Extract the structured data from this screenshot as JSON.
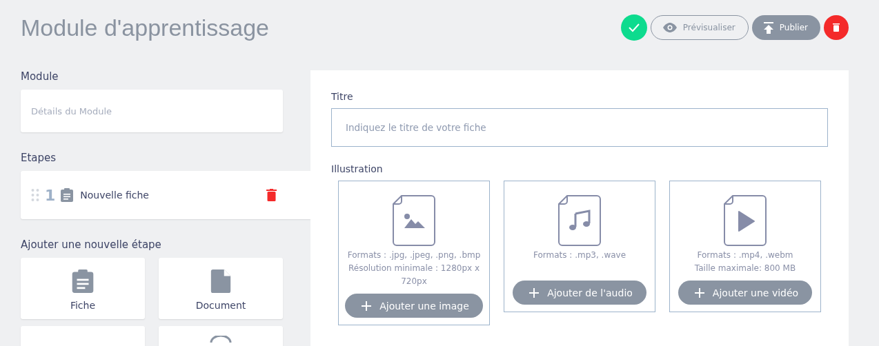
{
  "header": {
    "title": "Module d'apprentissage",
    "actions": [
      {
        "kind": "validate"
      },
      {
        "kind": "preview",
        "label": "Prévisualiser"
      },
      {
        "kind": "publish",
        "label": "Publier"
      },
      {
        "kind": "delete"
      }
    ]
  },
  "module": {
    "heading": "Module",
    "placeholder": "Détails du Module"
  },
  "steps": {
    "heading": "Etapes",
    "items": [
      {
        "number": "1",
        "kind": "sheet",
        "label": "Nouvelle fiche"
      }
    ]
  },
  "add_step": {
    "heading": "Ajouter une nouvelle étape",
    "options": [
      {
        "kind": "sheet",
        "label": "Fiche"
      },
      {
        "kind": "document",
        "label": "Document"
      },
      {
        "kind": "blank"
      },
      {
        "kind": "circle"
      }
    ]
  },
  "editor": {
    "title_label": "Titre",
    "title_placeholder": "Indiquez le titre de votre fiche",
    "illustration_label": "Illustration",
    "media": [
      {
        "kind": "image",
        "info": [
          "Formats : .jpg, .jpeg, .png, .bmp",
          "Résolution minimale : 1280px x 720px"
        ],
        "button": "Ajouter une image"
      },
      {
        "kind": "audio",
        "info": [
          "Formats : .mp3, .wave"
        ],
        "button": "Ajouter de l'audio"
      },
      {
        "kind": "video",
        "info": [
          "Formats : .mp4, .webm",
          "Taille maximale: 800 MB"
        ],
        "button": "Ajouter une vidéo"
      }
    ]
  }
}
